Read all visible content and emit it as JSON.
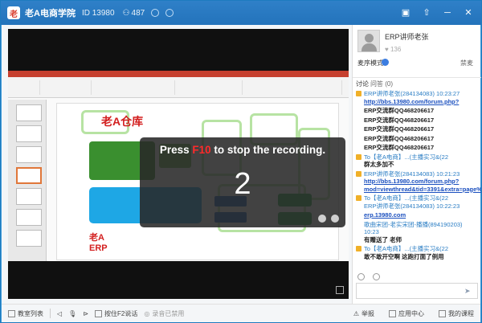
{
  "titlebar": {
    "logo_text": "老",
    "title": "老A电商学院",
    "id_text": "ID 13980",
    "users_count": "487"
  },
  "overlay": {
    "text_prefix": "Press ",
    "key": "F10",
    "text_suffix": " to stop the recording.",
    "countdown": "2"
  },
  "slide": {
    "title": "老A仓库",
    "logo": "老A ERP"
  },
  "teacher": {
    "name": "ERP讲师老张",
    "likes": "136",
    "mode_label": "麦序模式",
    "select_link": "禁麦"
  },
  "tabs": {
    "discussion": "讨论",
    "questions": "问答",
    "questions_count": "(0)"
  },
  "chat": [
    {
      "meta": "ERP讲师老张(284134083) 10:23:27",
      "link": "http://bbs.13980.com/forum.php?"
    },
    {
      "plain": "ERP交流群QQ468206617"
    },
    {
      "plain": "ERP交流群QQ468206617"
    },
    {
      "plain": "ERP交流群QQ468206617"
    },
    {
      "plain": "ERP交流群QQ468206617"
    },
    {
      "plain": "ERP交流群QQ468206617"
    },
    {
      "meta": "To【老A电商】...(主播实习&(22",
      "txt": "群太多加不"
    },
    {
      "meta": "ERP讲师老张(284134083) 10:21:23",
      "link": "http://bbs.13980.com/forum.php?mod=viewthread&tid=3391&extra=page%3D1"
    },
    {
      "meta": "To【老A电商】...(主播实习&(22",
      "txt": "ERP讲师老张(284134083) 10:22:23"
    },
    {
      "link": "erp.13980.com"
    },
    {
      "meta": "歌曲宋团-老实宋团-播播(894190203) 10:23",
      "txt": "有赠送了 老师"
    },
    {
      "meta": "To【老A电商】...(主播实习&(22",
      "txt": "敢不敢开空啊 这跑打面了例用"
    }
  ],
  "bottom": {
    "playlist": "教室列表",
    "hotkey": "按住F2说话",
    "record": "录音已禁用",
    "report": "举报",
    "app_center": "应用中心",
    "my_course": "我的课程"
  }
}
